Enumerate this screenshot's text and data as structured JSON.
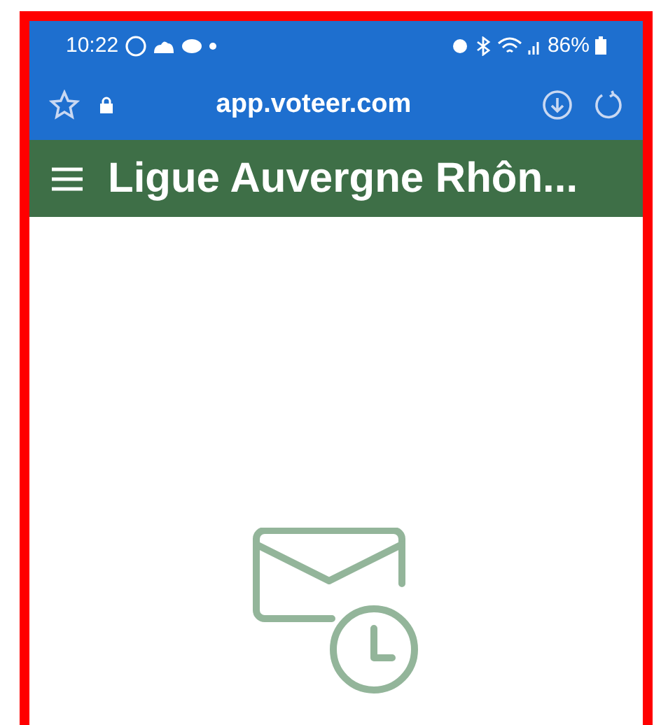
{
  "status_bar": {
    "time": "10:22",
    "battery": "86%"
  },
  "browser": {
    "url": "app.voteer.com"
  },
  "header": {
    "title": "Ligue Auvergne Rhôn..."
  }
}
